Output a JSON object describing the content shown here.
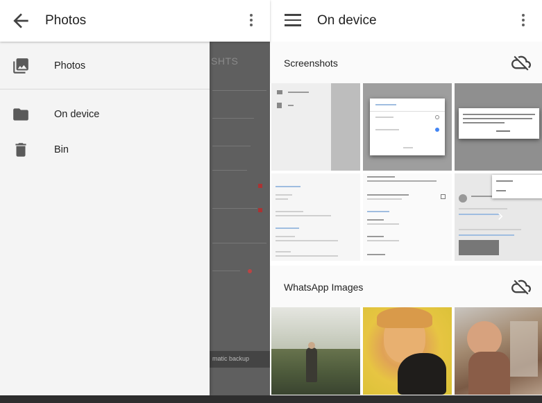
{
  "left_pane": {
    "title": "Photos",
    "back_icon": "arrow-back-icon",
    "overflow_icon": "more-vert-icon",
    "underlay_fragment": "SHTS",
    "underlay_footer": "matic backup",
    "drawer": {
      "items": [
        {
          "label": "Photos",
          "icon": "photo-library-icon"
        },
        {
          "label": "On device",
          "icon": "folder-icon"
        },
        {
          "label": "Bin",
          "icon": "trash-icon"
        }
      ]
    }
  },
  "right_pane": {
    "title": "On device",
    "menu_icon": "hamburger-menu-icon",
    "overflow_icon": "more-vert-icon",
    "sections": [
      {
        "name": "Screenshots",
        "sync_icon": "cloud-off-icon"
      },
      {
        "name": "WhatsApp Images",
        "sync_icon": "cloud-off-icon"
      }
    ],
    "screenshot_thumbnails": [
      {
        "lines": [
          "On device",
          "Bin"
        ]
      },
      {
        "dialog_title": "Photo size",
        "options": [
          "Full size",
          "Standard size"
        ],
        "action": "Cancel"
      },
      {
        "dialog_text": "Any photos and videos taken while Auto-backup is turned off will be backed up if and when you turn it back on.",
        "action": "OK, got it"
      },
      {
        "lines": [
          "Backup Storage",
          "Photo size",
          "Full size",
          "Get more storage",
          "Backup Settings",
          "Back up photos"
        ]
      },
      {
        "lines": [
          "Automatically back up new photos and videos to Google Photos",
          "Conserve data usage",
          "Account Settings",
          "Add account"
        ]
      },
      {
        "lines": [
          "Feedback",
          "Help",
          "James Burr"
        ]
      }
    ],
    "colors": {
      "accent": "#4285f4",
      "dim": "#5f5f5f"
    }
  }
}
